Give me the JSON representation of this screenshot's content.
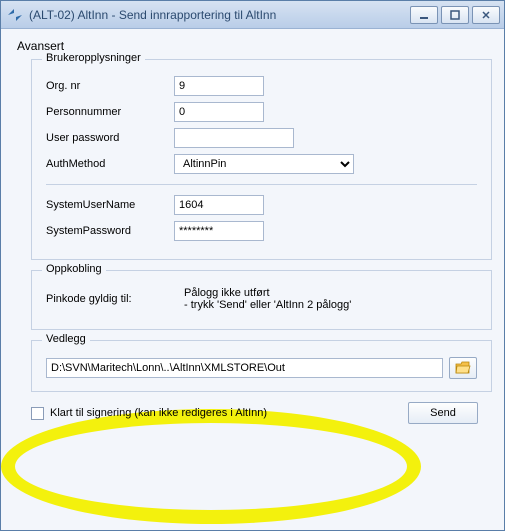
{
  "title": "(ALT-02) AltInn - Send innrapportering til AltInn",
  "section": "Avansert",
  "groups": {
    "bruker": {
      "legend": "Brukeropplysninger",
      "orgnr_label": "Org. nr",
      "orgnr_value": "9",
      "person_label": "Personnummer",
      "person_value": "0",
      "userpw_label": "User password",
      "userpw_value": "",
      "authmethod_label": "AuthMethod",
      "authmethod_value": "AltinnPin",
      "sysuser_label": "SystemUserName",
      "sysuser_value": "1604",
      "syspw_label": "SystemPassword",
      "syspw_value": "********"
    },
    "oppkobling": {
      "legend": "Oppkobling",
      "pinkode_label": "Pinkode gyldig til:",
      "status_line1": "Pålogg ikke utført",
      "status_line2": "- trykk 'Send' eller 'AltInn 2 pålogg'"
    },
    "vedlegg": {
      "legend": "Vedlegg",
      "path": "D:\\SVN\\Maritech\\Lonn\\..\\AltInn\\XMLSTORE\\Out"
    }
  },
  "footer": {
    "checkbox_label": "Klart til signering (kan ikke redigeres i AltInn)",
    "send_label": "Send"
  }
}
